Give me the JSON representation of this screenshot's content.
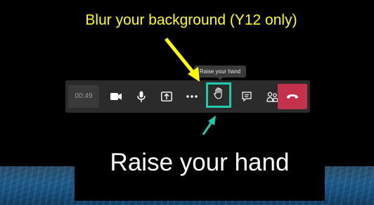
{
  "annotations": {
    "top_caption": "Blur your background (Y12 only)",
    "bottom_caption": "Raise your hand",
    "top_caption_color": "#ffff00",
    "highlight_color": "#1ecbab"
  },
  "tooltip": {
    "text": "Raise your hand"
  },
  "toolbar": {
    "timer": "00:49",
    "buttons": [
      {
        "name": "camera",
        "icon": "video-camera-icon"
      },
      {
        "name": "microphone",
        "icon": "microphone-icon"
      },
      {
        "name": "share",
        "icon": "share-screen-icon"
      },
      {
        "name": "more",
        "icon": "more-options-icon"
      },
      {
        "name": "raise-hand",
        "icon": "raise-hand-icon"
      },
      {
        "name": "chat",
        "icon": "chat-icon"
      },
      {
        "name": "participants",
        "icon": "participants-icon"
      },
      {
        "name": "hang-up",
        "icon": "hang-up-icon"
      }
    ],
    "hangup_color": "#c4314b"
  }
}
